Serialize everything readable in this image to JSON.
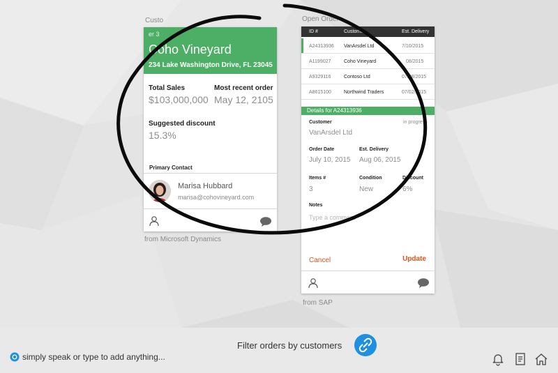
{
  "customer": {
    "caption": "Custo",
    "tier": "er 3",
    "name": "Coho Vineyard",
    "address": "234 Lake Washington Drive, FL 23045",
    "total_sales_label": "Total Sales",
    "total_sales_value": "$103,000,000",
    "recent_order_label": "Most recent order",
    "recent_order_value": "May 12, 2105",
    "discount_label": "Suggested discount",
    "discount_value": "15.3%",
    "primary_contact_label": "Primary Contact",
    "contact_name": "Marisa Hubbard",
    "contact_email": "marisa@cohovineyard.com",
    "source": "from Microsoft Dynamics"
  },
  "orders": {
    "caption": "Open Order",
    "columns": [
      "ID #",
      "Customer",
      "Est. Delivery"
    ],
    "rows": [
      {
        "id": "A24313936",
        "customer": "VanArsdel Ltd",
        "date": "7/10/2015"
      },
      {
        "id": "A1199027",
        "customer": "Coho Vineyard",
        "date": "08/2015"
      },
      {
        "id": "A9329116",
        "customer": "Contoso Ltd",
        "date": "07/08/2015"
      },
      {
        "id": "A8615100",
        "customer": "Northwind Traders",
        "date": "07/02/2015"
      }
    ],
    "details_title": "Details for A24313936",
    "customer_label": "Customer",
    "status": "in progress",
    "customer_value": "VanArsdel Ltd",
    "order_date_label": "Order Date",
    "order_date_value": "July 10, 2015",
    "est_delivery_label": "Est. Delivery",
    "est_delivery_value": "Aug 06, 2015",
    "items_label": "Items #",
    "items_value": "3",
    "condition_label": "Condition",
    "condition_value": "New",
    "discount_label": "Discount",
    "discount_value": "6%",
    "notes_label": "Notes",
    "notes_placeholder": "Type a comment",
    "cancel_label": "Cancel",
    "update_label": "Update",
    "source": "from SAP"
  },
  "bottom": {
    "filter_text": "Filter orders by customers",
    "speak_text": "simply speak or type to add anything..."
  },
  "colors": {
    "accent_green": "#4caf65",
    "action_orange": "#d9531e",
    "link_blue": "#1e8fe1"
  },
  "icons": [
    "person-icon",
    "chat-bubble-icon",
    "link-icon",
    "bell-icon",
    "notes-icon",
    "home-icon",
    "mic-indicator-icon"
  ]
}
